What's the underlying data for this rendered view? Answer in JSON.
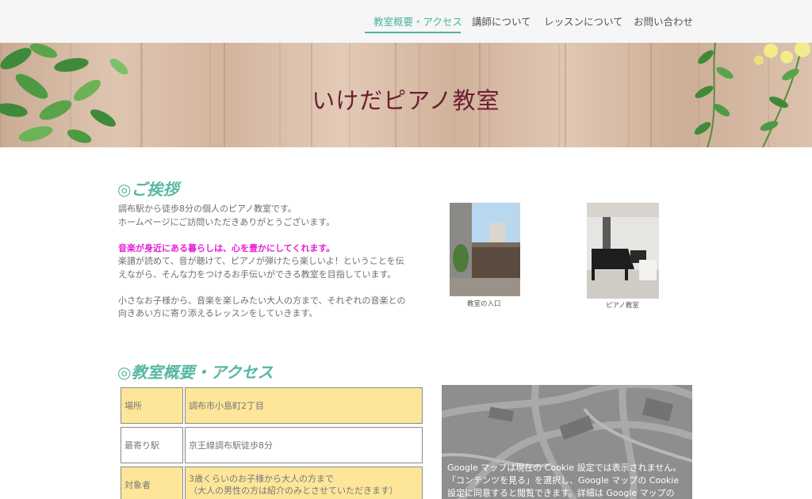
{
  "nav": {
    "items": [
      {
        "label": "教室概要・アクセス",
        "active": true
      },
      {
        "label": "講師について",
        "active": false
      },
      {
        "label": "レッスンについて",
        "active": false
      },
      {
        "label": "お問い合わせ",
        "active": false
      }
    ],
    "accent_color": "#4fb3a3"
  },
  "hero": {
    "title": "いけだピアノ教室",
    "title_color": "#6d1d33"
  },
  "greeting": {
    "heading": "◎ご挨拶",
    "lines": [
      "調布駅から徒歩8分の個人のピアノ教室です。",
      "ホームページにご訪問いただきありがとうございます。"
    ],
    "highlight": "音楽が身近にある暮らしは、心を豊かにしてくれます。",
    "paragraph2": [
      "楽譜が読めて、音が聴けて、ピアノが弾けたら楽しいよ！ということを伝",
      "えながら、そんな力をつけるお手伝いができる教室を目指しています。"
    ],
    "paragraph3": [
      "小さなお子様から、音楽を楽しみたい大人の方まで、それぞれの音楽との",
      "向きあい方に寄り添えるレッスンをしていきます。"
    ],
    "highlight_color": "#e61ed7"
  },
  "photos": [
    {
      "caption": "教室の入口",
      "icon": "entrance-photo"
    },
    {
      "caption": "ピアノ教室",
      "icon": "piano-room-photo"
    }
  ],
  "overview": {
    "heading": "◎教室概要・アクセス",
    "rows": [
      {
        "label": "場所",
        "value": [
          "調布市小島町2丁目"
        ]
      },
      {
        "label": "最寄り駅",
        "value": [
          "京王線調布駅徒歩8分"
        ]
      },
      {
        "label": "対象者",
        "value": [
          "3歳くらいのお子様から大人の方まで",
          "（大人の男性の方は紹介のみとさせていただきます）"
        ]
      }
    ]
  },
  "map": {
    "notice": [
      "Google マップは現在の Cookie 設定では表示されません。",
      "「コンテンツを見る」を選択し、Google マップの Cookie",
      "設定に同意すると閲覧できます。詳細は Google マップの"
    ]
  }
}
